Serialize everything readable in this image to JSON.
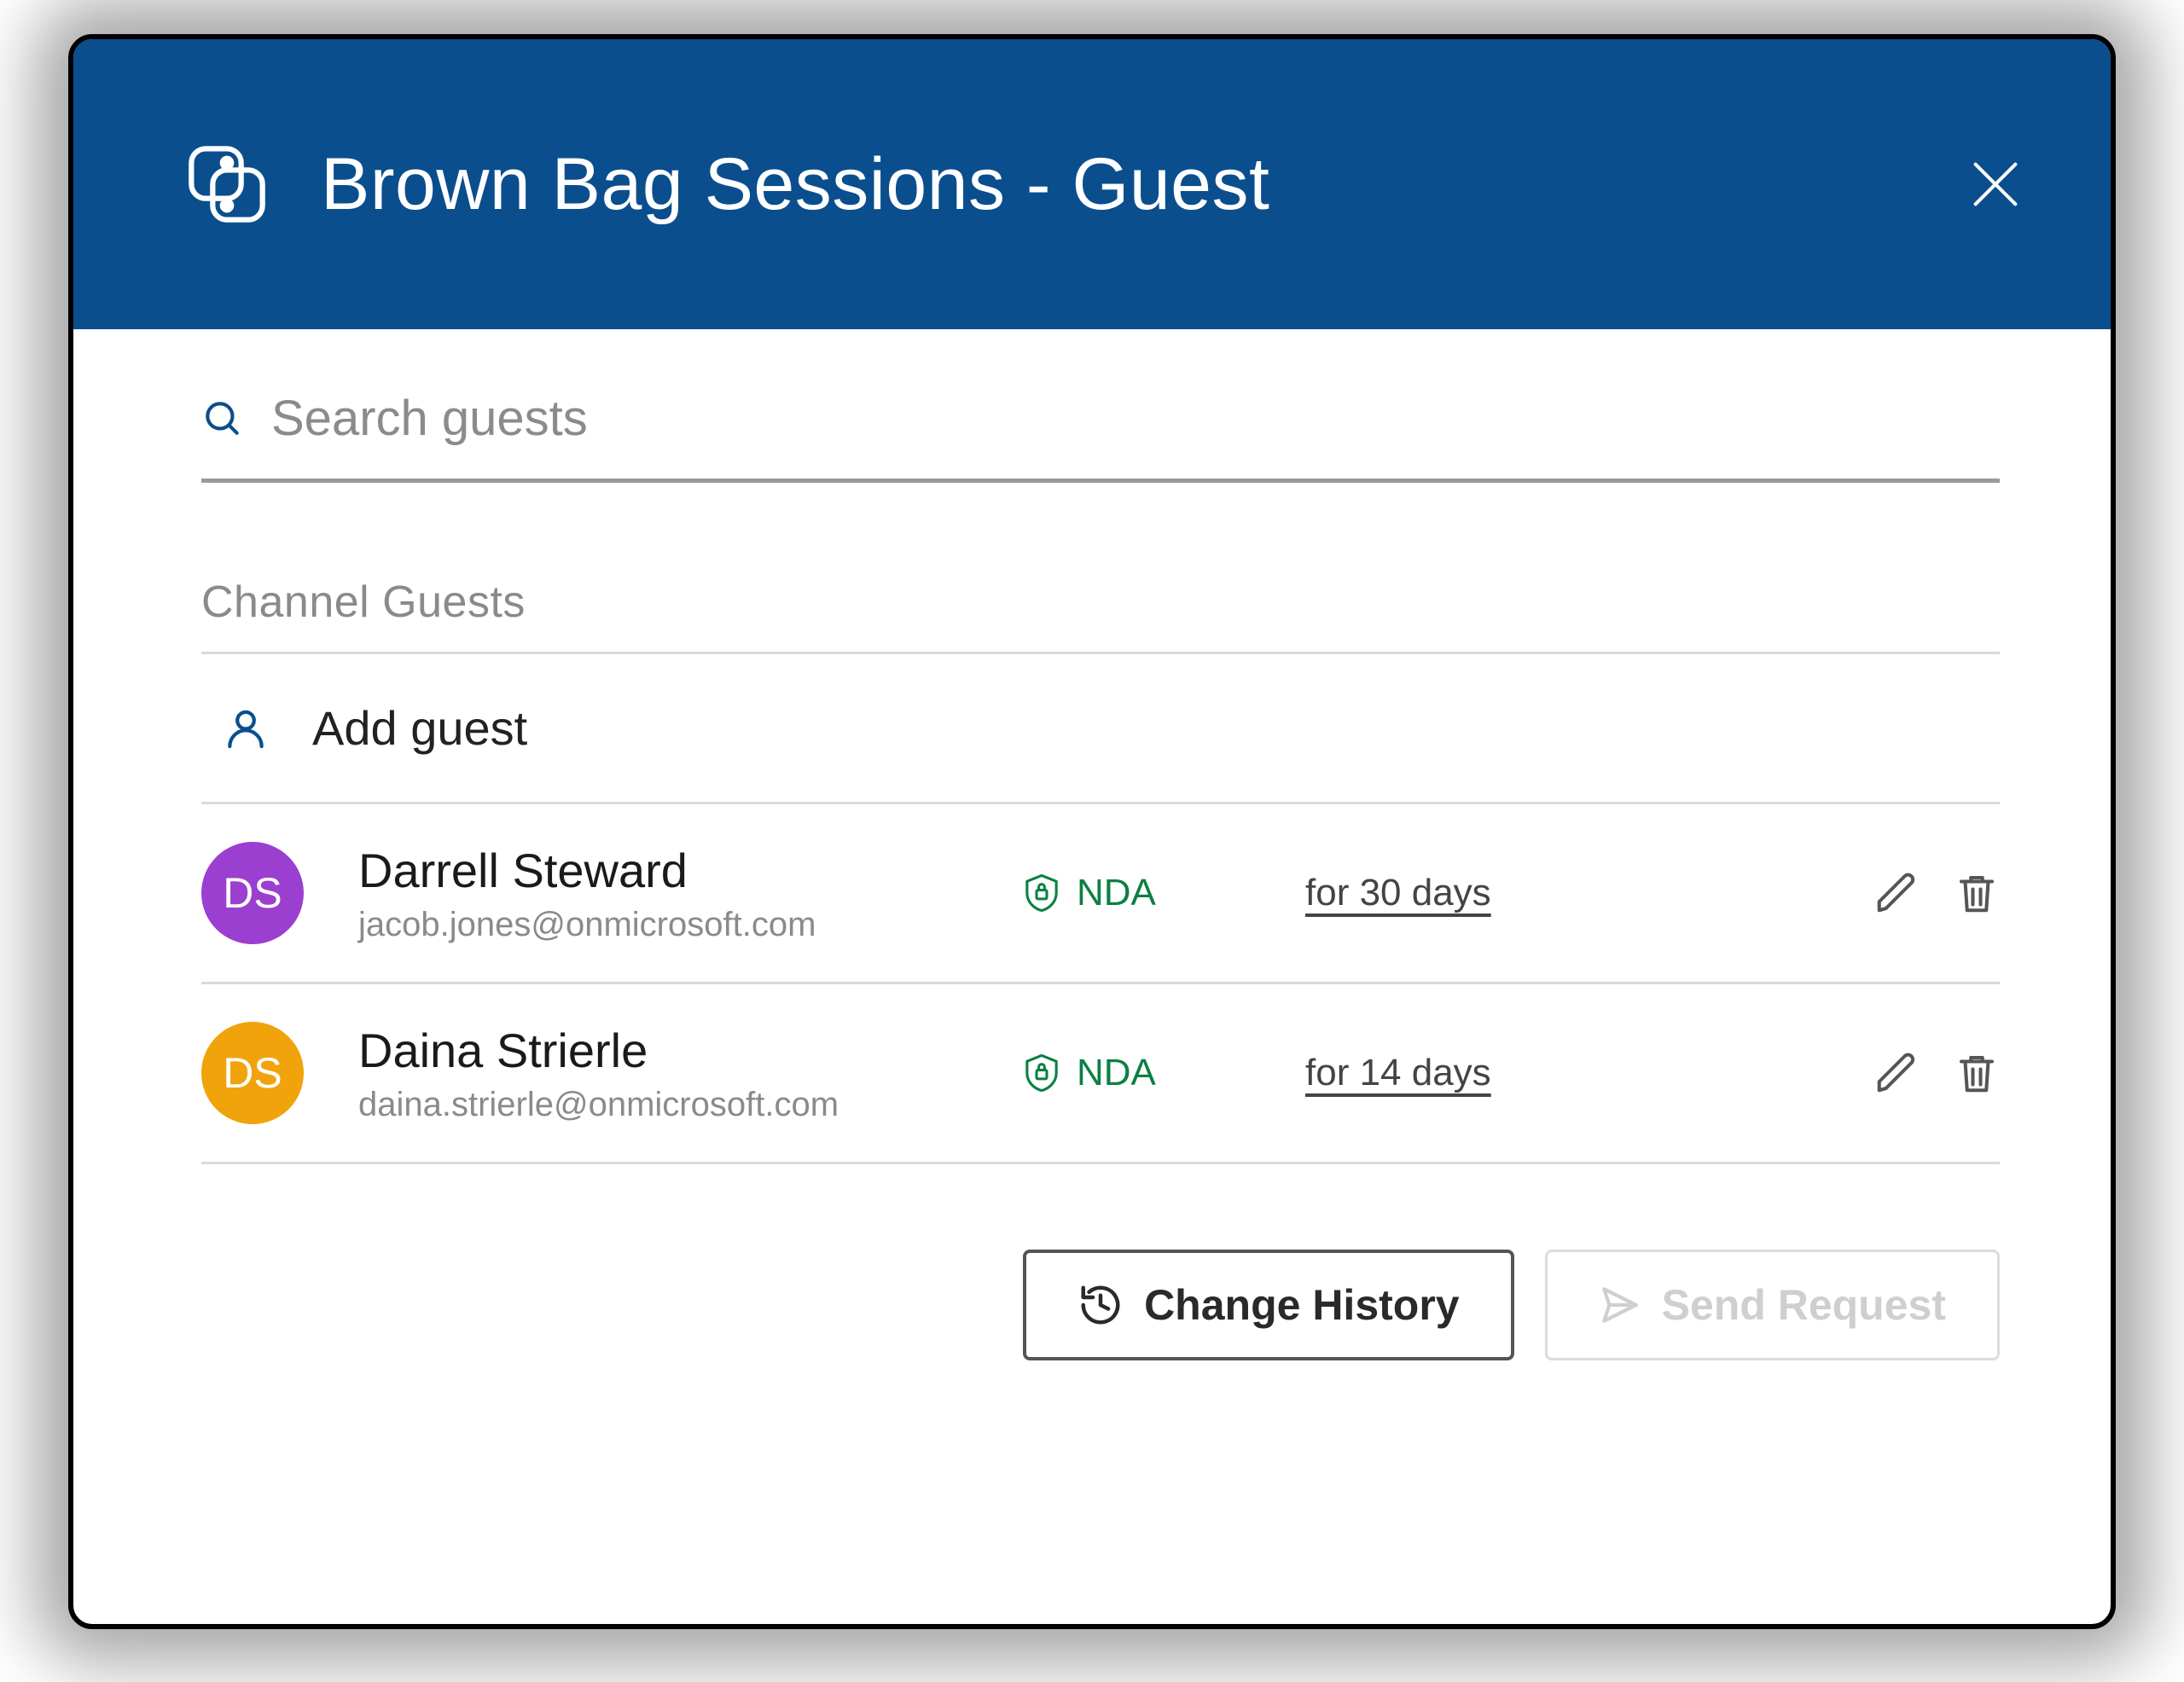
{
  "header": {
    "title": "Brown Bag Sessions - Guest"
  },
  "search": {
    "placeholder": "Search guests"
  },
  "section": {
    "heading": "Channel Guests",
    "add_guest_label": "Add guest"
  },
  "guests": [
    {
      "initials": "DS",
      "name": "Darrell Steward",
      "email": "jacob.jones@onmicrosoft.com",
      "nda_label": "NDA",
      "duration": "for 30 days",
      "avatar_color": "#9b3fd1"
    },
    {
      "initials": "DS",
      "name": "Daina Strierle",
      "email": "daina.strierle@onmicrosoft.com",
      "nda_label": "NDA",
      "duration": "for 14 days",
      "avatar_color": "#f0a30a"
    }
  ],
  "footer": {
    "history_label": "Change History",
    "send_label": "Send Request"
  }
}
